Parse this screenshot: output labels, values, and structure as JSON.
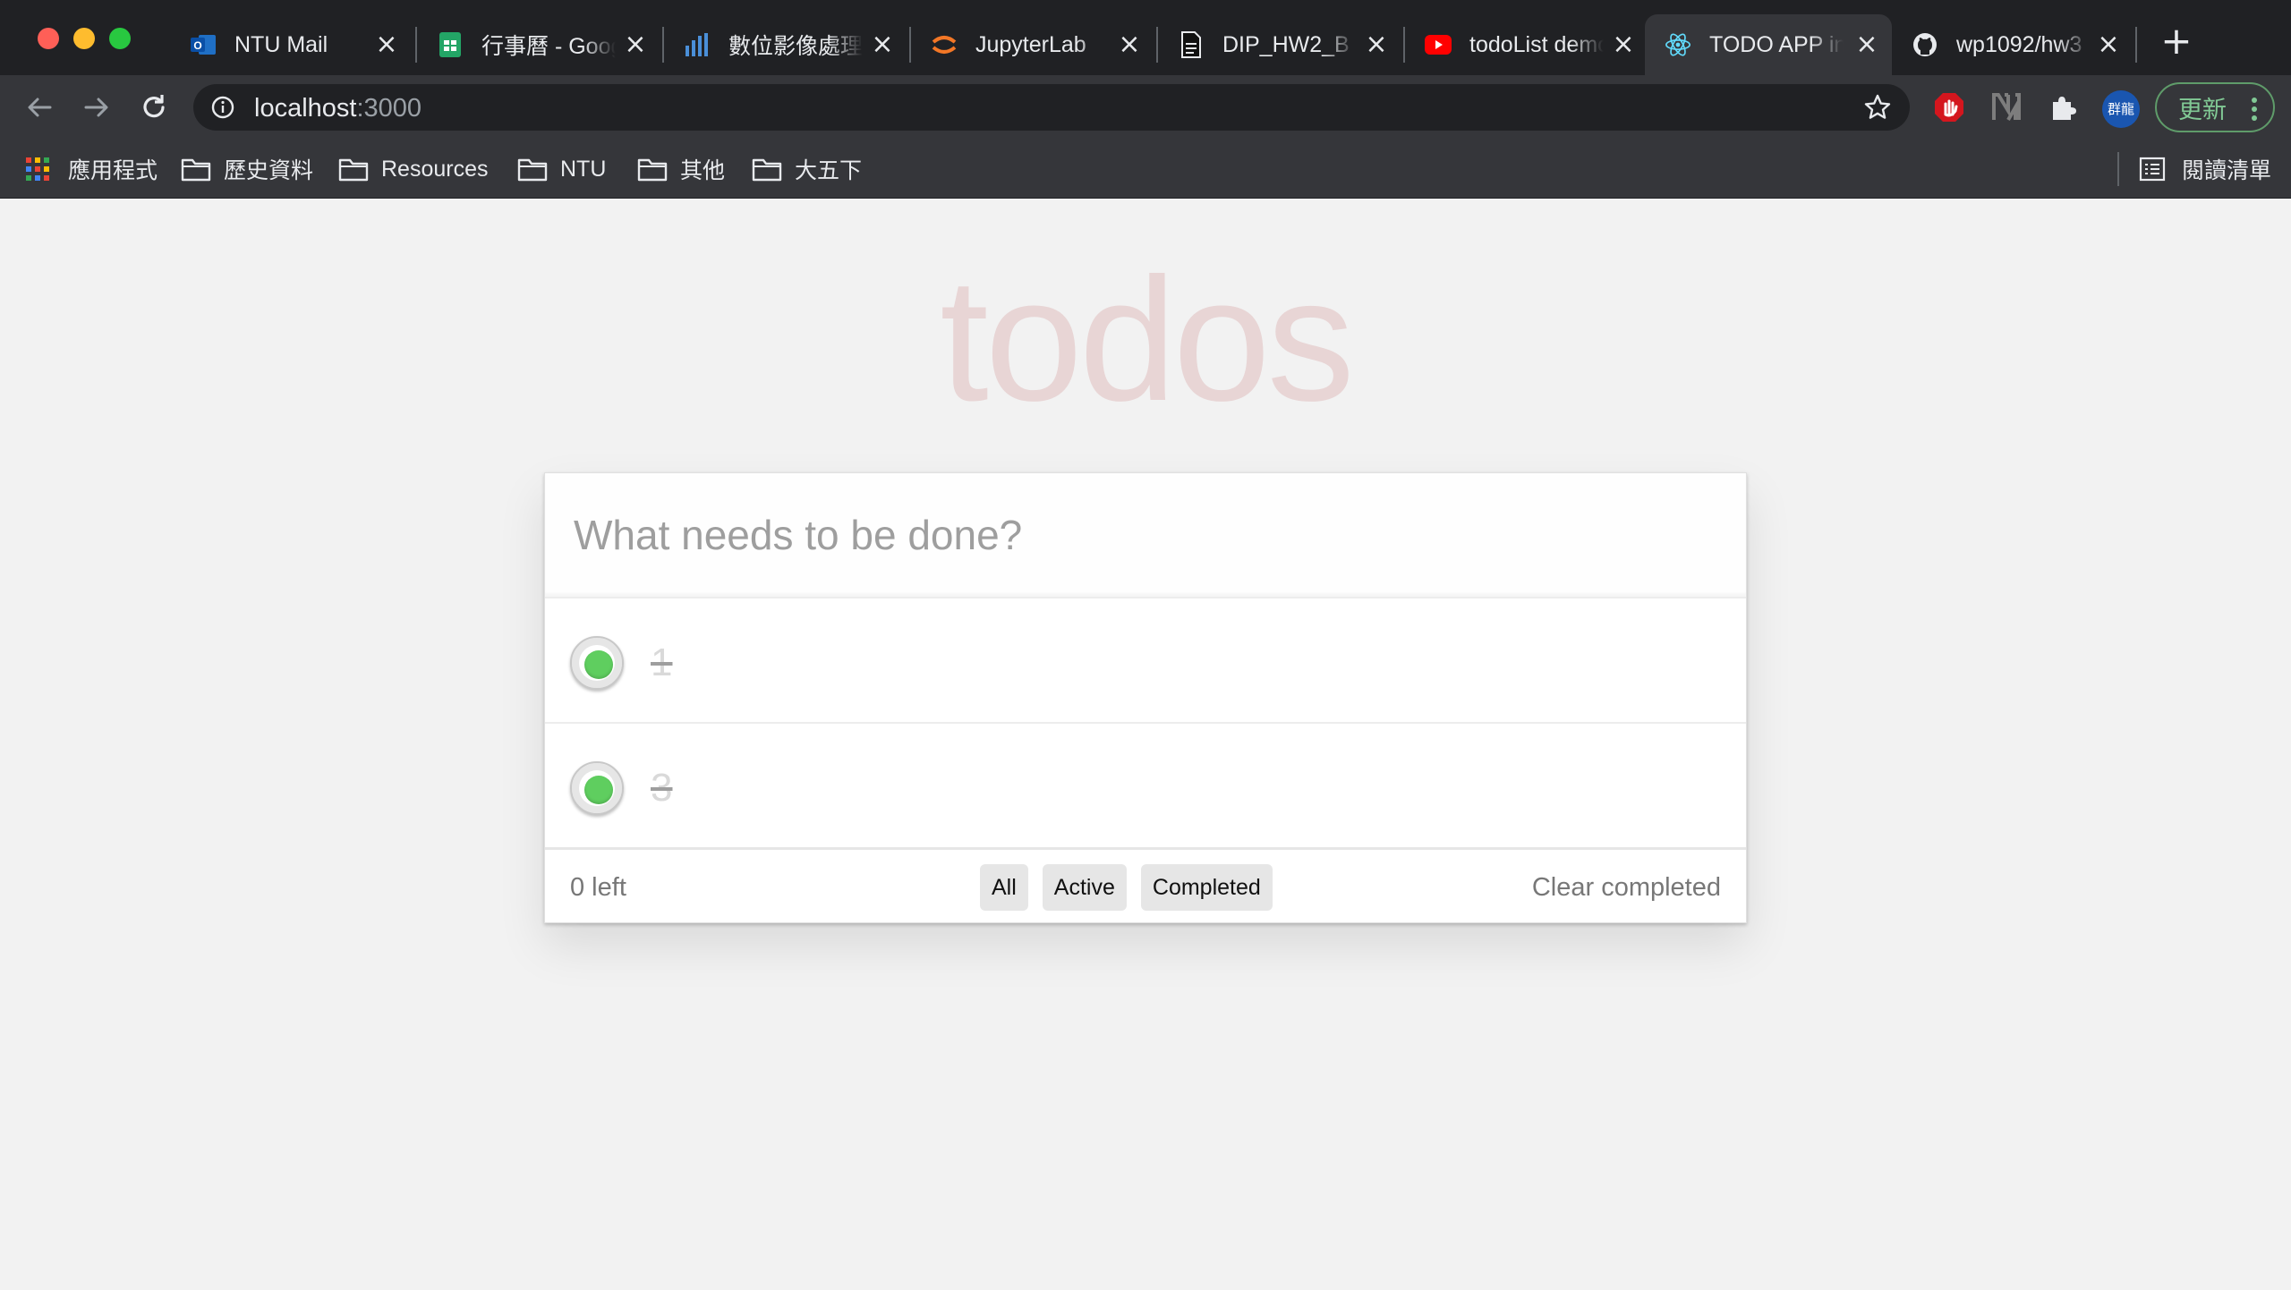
{
  "browser": {
    "tabs": [
      {
        "title": "NTU Mail",
        "icon": "outlook-icon"
      },
      {
        "title": "行事曆 - Google 試算表",
        "icon": "google-sheets-icon"
      },
      {
        "title": "數位影像處理",
        "icon": "bar-chart-icon"
      },
      {
        "title": "JupyterLab",
        "icon": "jupyter-icon"
      },
      {
        "title": "DIP_HW2_B",
        "icon": "document-icon"
      },
      {
        "title": "todoList demo",
        "icon": "youtube-icon"
      },
      {
        "title": "TODO APP in",
        "icon": "react-icon",
        "active": true
      },
      {
        "title": "wp1092/hw3",
        "icon": "github-icon"
      }
    ],
    "url_host": "localhost",
    "url_port": ":3000",
    "update_label": "更新",
    "profile_label": "群龍",
    "bookmarks": [
      {
        "label": "應用程式",
        "icon": "apps-grid-icon"
      },
      {
        "label": "歷史資料",
        "icon": "folder-icon"
      },
      {
        "label": "Resources",
        "icon": "folder-icon"
      },
      {
        "label": "NTU",
        "icon": "folder-icon"
      },
      {
        "label": "其他",
        "icon": "folder-icon"
      },
      {
        "label": "大五下",
        "icon": "folder-icon"
      }
    ],
    "reading_list": "閱讀清單",
    "colors": {
      "accent_green": "#81c995",
      "chrome_dark": "#202124",
      "chrome_toolbar": "#35363a"
    }
  },
  "app": {
    "title": "todos",
    "input_placeholder": "What needs to be done?",
    "todos": [
      {
        "text": "1",
        "completed": true
      },
      {
        "text": "3",
        "completed": true
      }
    ],
    "footer": {
      "count": "0 left",
      "filters": [
        "All",
        "Active",
        "Completed"
      ],
      "clear_label": "Clear completed"
    },
    "colors": {
      "title": "#e6cfcf",
      "check": "#5fce5f",
      "background": "#f2f2f2"
    }
  }
}
